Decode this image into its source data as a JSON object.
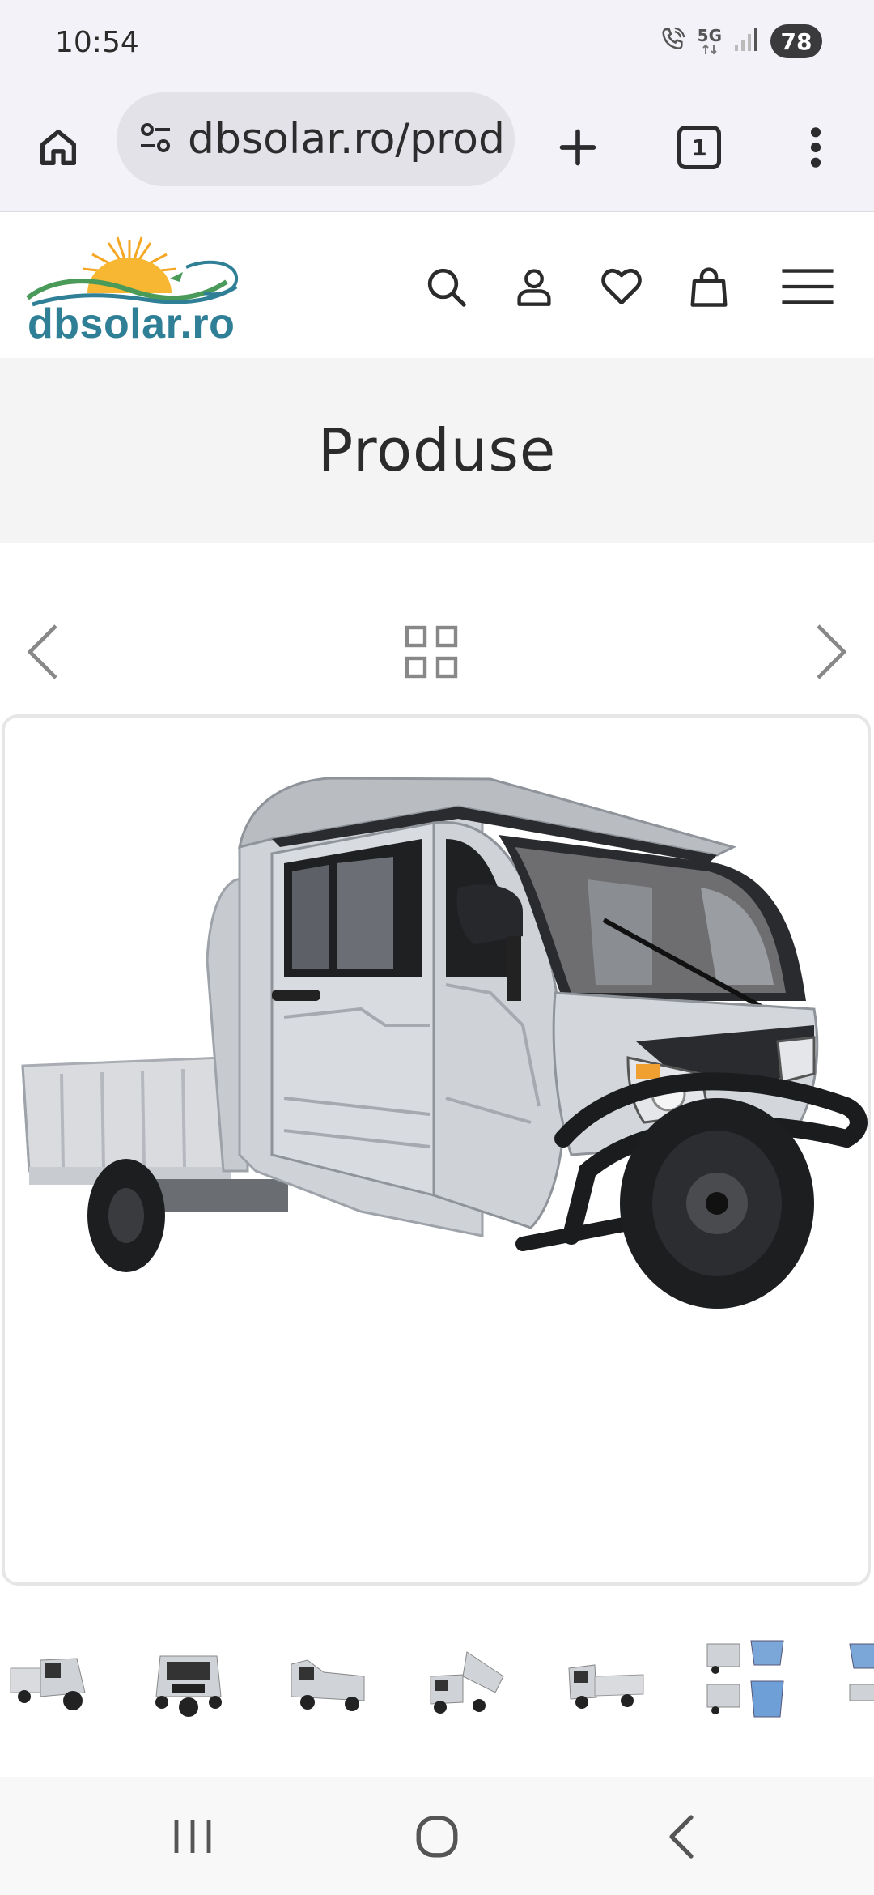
{
  "status_bar": {
    "time": "10:54",
    "network": "5G",
    "battery": "78",
    "icons": [
      "wifi-calling-icon",
      "5g-icon",
      "signal-icon",
      "battery-icon"
    ]
  },
  "browser": {
    "url": "dbsolar.ro/prod",
    "tab_count": "1",
    "icons": [
      "home-icon",
      "site-settings-icon",
      "new-tab-icon",
      "tabs-icon",
      "overflow-menu-icon"
    ]
  },
  "site": {
    "logo_text": "dbsolar.ro",
    "header_icons": [
      "search-icon",
      "account-icon",
      "wishlist-icon",
      "cart-icon",
      "hamburger-menu-icon"
    ],
    "page_title": "Produse"
  },
  "product_nav": {
    "icons": [
      "chevron-left-icon",
      "grid-icon",
      "chevron-right-icon"
    ]
  },
  "gallery": {
    "thumbnail_count": 7
  },
  "system_nav": {
    "icons": [
      "recents-icon",
      "home-circle-icon",
      "back-icon"
    ]
  },
  "colors": {
    "logo_blue": "#2f7f97",
    "logo_sun": "#f5a623",
    "browser_bg": "#f3f2f8",
    "title_band": "#f4f4f4"
  }
}
